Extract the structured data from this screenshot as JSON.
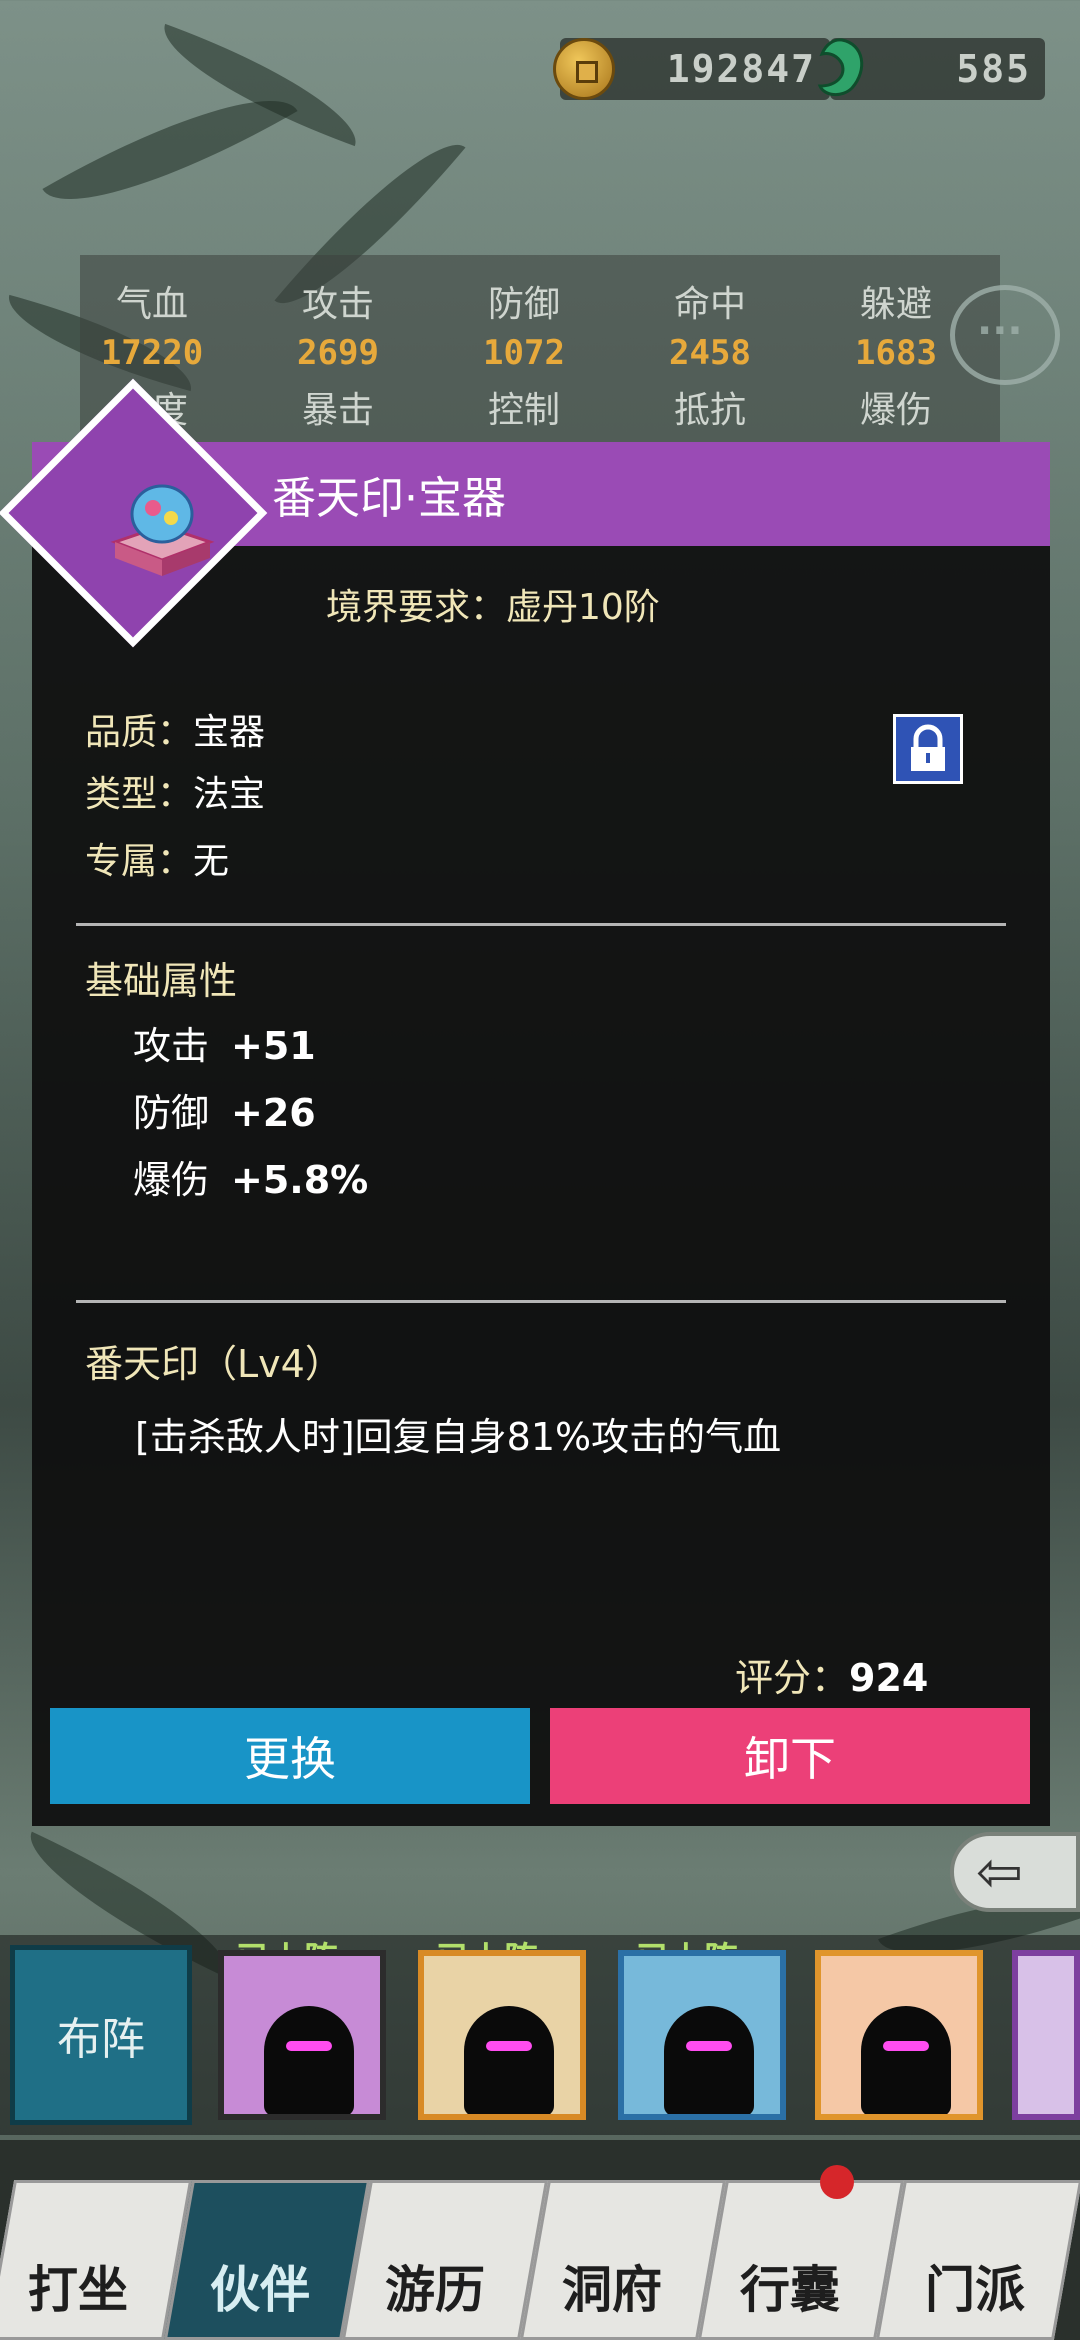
{
  "currency": {
    "gold": "192847",
    "jade": "585"
  },
  "stats": {
    "row1": [
      {
        "label": "气血",
        "value": "17220"
      },
      {
        "label": "攻击",
        "value": "2699"
      },
      {
        "label": "防御",
        "value": "1072"
      },
      {
        "label": "命中",
        "value": "2458"
      },
      {
        "label": "躲避",
        "value": "1683"
      }
    ],
    "row2": [
      "速度",
      "暴击",
      "控制",
      "抵抗",
      "爆伤"
    ]
  },
  "item": {
    "title": "番天印·宝器",
    "requirement": "境界要求：虚丹10阶",
    "quality_label": "品质：",
    "quality": "宝器",
    "type_label": "类型：",
    "type": "法宝",
    "exclusive_label": "专属：",
    "exclusive": "无",
    "base_attr_title": "基础属性",
    "attrs": [
      {
        "name": "攻击",
        "value": "+51"
      },
      {
        "name": "防御",
        "value": "+26"
      },
      {
        "name": "爆伤",
        "value": "+5.8%"
      }
    ],
    "skill_title": "番天印（Lv4）",
    "skill_desc": "[击杀敌人时]回复自身81%攻击的气血",
    "score_label": "评分：",
    "score": "924",
    "btn_change": "更换",
    "btn_unequip": "卸下"
  },
  "roster": {
    "lineup_label": "布阵",
    "deployed_label": "已上阵"
  },
  "nav": [
    "打坐",
    "伙伴",
    "游历",
    "洞府",
    "行囊",
    "门派"
  ],
  "colors": {
    "header": "#9a4bb5",
    "change": "#1894c7",
    "unequip": "#ec4078",
    "accent": "#e7a93b"
  }
}
